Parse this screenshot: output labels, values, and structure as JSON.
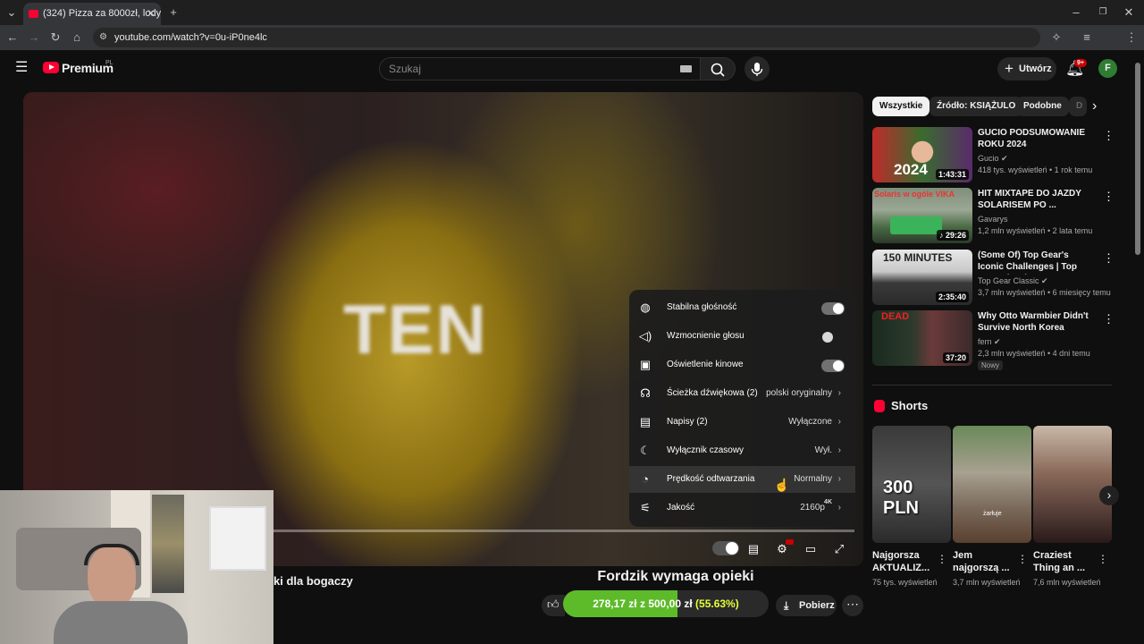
{
  "browser": {
    "tab_title": "(324) Pizza za 8000zł, lody za 4",
    "url": "youtube.com/watch?v=0u-iP0ne4lc",
    "profile_initial": "F"
  },
  "header": {
    "logo": "Premium",
    "region": "PL",
    "search_placeholder": "Szukaj",
    "create_label": "Utwórz",
    "notif_count": "9+",
    "avatar_initial": "F"
  },
  "video": {
    "overlay_text": "TEN",
    "title": "Fordzik wymaga opieki",
    "left_title": "ki dla bogaczy",
    "download_label": "Pobierz"
  },
  "settings": {
    "items": [
      {
        "label": "Stabilna głośność",
        "toggle": true
      },
      {
        "label": "Wzmocnienie głosu",
        "toggle": false
      },
      {
        "label": "Oświetlenie kinowe",
        "toggle": true
      },
      {
        "label": "Ścieżka dźwiękowa (2)",
        "value": "polski oryginalny"
      },
      {
        "label": "Napisy (2)",
        "value": "Wyłączone"
      },
      {
        "label": "Wyłącznik czasowy",
        "value": "Wył."
      },
      {
        "label": "Prędkość odtwarzania",
        "value": "Normalny"
      },
      {
        "label": "Jakość",
        "value": "2160p",
        "badge": "4K"
      }
    ]
  },
  "donation": {
    "current": "278,17 zł",
    "separator": "z",
    "goal": "500,00 zł",
    "percent": "(55.63%)",
    "fraction": 0.5563
  },
  "chips": [
    "Wszystkie",
    "Źródło: KSIĄŻULO",
    "Podobne",
    "D"
  ],
  "recommendations": [
    {
      "title": "GUCIO PODSUMOWANIE ROKU 2024",
      "channel": "Gucio",
      "verified": true,
      "meta": "418 tys. wyświetleń • 1 rok temu",
      "duration": "1:43:31"
    },
    {
      "title": "HIT MIXTAPE DO JAZDY SOLARISEM PO ...",
      "channel": "Gavarys",
      "verified": false,
      "meta": "1,2 mln wyświetleń • 2 lata temu",
      "duration": "29:26"
    },
    {
      "title": "(Some Of) Top Gear's Iconic Challenges | Top Gear Classic",
      "channel": "Top Gear Classic",
      "verified": true,
      "meta": "3,7 mln wyświetleń • 6 miesięcy temu",
      "duration": "2:35:40"
    },
    {
      "title": "Why Otto Warmbier Didn't Survive North Korea",
      "channel": "fern",
      "verified": true,
      "meta": "2,3 mln wyświetleń • 4 dni temu",
      "duration": "37:20",
      "badge": "Nowy"
    }
  ],
  "thumb_text": {
    "t1": "2024",
    "t2": "Solaris w ogóle VIKA",
    "t3": "150 MINUTES",
    "t4": "DEAD"
  },
  "shorts": {
    "heading": "Shorts",
    "items": [
      {
        "title": "Najgorsza AKTUALIZ...",
        "views": "75 tys. wyświetleń",
        "overlay": "300 PLN"
      },
      {
        "title": "Jem najgorszą ...",
        "views": "3,7 mln wyświetleń",
        "overlay": "żarłuje"
      },
      {
        "title": "Craziest Thing an ...",
        "views": "7,6 mln wyświetleń",
        "overlay": ""
      }
    ]
  },
  "colors": {
    "accent_red": "#ff0033",
    "donation_green": "#5dbb2a",
    "background": "#0f0f0f"
  }
}
